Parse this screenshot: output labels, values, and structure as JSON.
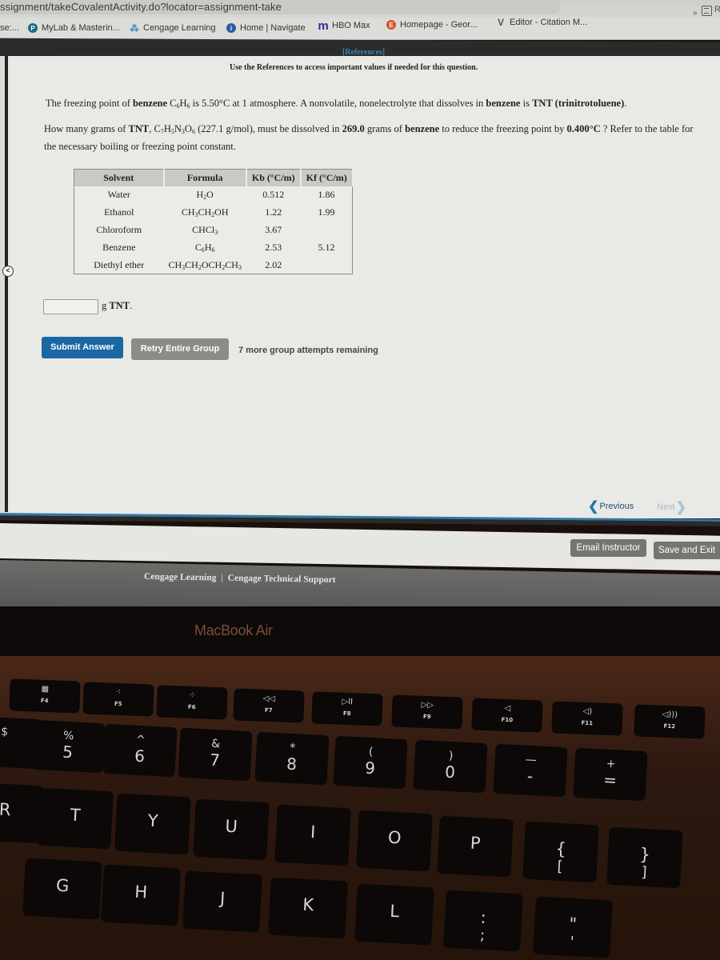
{
  "browser": {
    "url": "ssignment/takeCovalentActivity.do?locator=assignment-take",
    "bookmarks_overflow_left": "se:...",
    "bookmarks": [
      {
        "label": "MyLab & Masterin...",
        "icon": "pearson-icon"
      },
      {
        "label": "Cengage Learning",
        "icon": "cengage-icon"
      },
      {
        "label": "Home | Navigate",
        "icon": "navigate-icon"
      },
      {
        "label": "HBO Max",
        "icon": "hbo-max-icon"
      },
      {
        "label": "Homepage - Geor...",
        "icon": "georgia-icon"
      },
      {
        "label": "Editor - Citation M...",
        "icon": "citation-machine-icon"
      }
    ],
    "overflow_chevron": "»",
    "reading_list_label": "R"
  },
  "page": {
    "references_link": "[References]",
    "references_note": "Use the References to access important values if needed for this question.",
    "question_intro": {
      "t1": "The freezing point of ",
      "b1": "benzene",
      "t2": " C",
      "s1": "6",
      "t3": "H",
      "s2": "6",
      "t4": " is 5.50°C at 1 atmosphere. A nonvolatile, nonelectrolyte that dissolves in ",
      "b2": "benzene",
      "t5": " is ",
      "b3": "TNT (trinitrotoluene)",
      "t6": "."
    },
    "question_body": {
      "t1": "How many grams of ",
      "b1": "TNT",
      "t2": ", C",
      "s1": "7",
      "t3": "H",
      "s2": "5",
      "t4": "N",
      "s3": "3",
      "t5": "O",
      "s4": "6",
      "t6": " (227.1 g/mol), must be dissolved in ",
      "b2": "269.0",
      "t7": " grams of ",
      "b3": "benzene",
      "t8": " to reduce the freezing point by ",
      "b4": "0.400°C",
      "t9": " ? Refer to the table for the necessary boiling or freezing point constant."
    },
    "table": {
      "headers": {
        "solvent": "Solvent",
        "formula": "Formula",
        "kb": "Kb (°C/m)",
        "kf": "Kf (°C/m)"
      },
      "rows": [
        {
          "solvent": "Water",
          "formula": "H2O",
          "kb": "0.512",
          "kf": "1.86"
        },
        {
          "solvent": "Ethanol",
          "formula": "CH3CH2OH",
          "kb": "1.22",
          "kf": "1.99"
        },
        {
          "solvent": "Chloroform",
          "formula": "CHCl3",
          "kb": "3.67",
          "kf": ""
        },
        {
          "solvent": "Benzene",
          "formula": "C6H6",
          "kb": "2.53",
          "kf": "5.12"
        },
        {
          "solvent": "Diethyl ether",
          "formula": "CH3CH2OCH2CH3",
          "kb": "2.02",
          "kf": ""
        }
      ]
    },
    "answer": {
      "value": "",
      "unit_prefix": "g ",
      "unit": "TNT",
      "unit_suffix": "."
    },
    "buttons": {
      "submit": "Submit Answer",
      "retry": "Retry Entire Group",
      "attempts": "7 more group attempts remaining"
    },
    "nav": {
      "previous": "Previous",
      "next": "Next"
    },
    "actions": {
      "email": "Email Instructor",
      "save": "Save and Exit"
    },
    "footer": {
      "left": "Cengage Learning",
      "separator": "|",
      "right": "Cengage Technical Support"
    },
    "colors": {
      "primary": "#1b67a4",
      "secondary": "#8b8b88",
      "link": "#3d84b0"
    }
  },
  "device": {
    "label": "MacBook Air",
    "fkeys": [
      {
        "icon": "▦",
        "label": "F4",
        "name": "launchpad"
      },
      {
        "icon": "⁖",
        "label": "F5",
        "name": "keyboard-dim"
      },
      {
        "icon": "⁘",
        "label": "F6",
        "name": "keyboard-bright"
      },
      {
        "icon": "◁◁",
        "label": "F7",
        "name": "rewind"
      },
      {
        "icon": "▷II",
        "label": "F8",
        "name": "play-pause"
      },
      {
        "icon": "▷▷",
        "label": "F9",
        "name": "fast-forward"
      },
      {
        "icon": "◁",
        "label": "F10",
        "name": "mute"
      },
      {
        "icon": "◁)",
        "label": "F11",
        "name": "volume-down"
      },
      {
        "icon": "◁)))",
        "label": "F12",
        "name": "volume-up"
      }
    ],
    "number_keys": [
      {
        "top": "$",
        "bot": ""
      },
      {
        "top": "%",
        "bot": "5"
      },
      {
        "top": "^",
        "bot": "6"
      },
      {
        "top": "&",
        "bot": "7"
      },
      {
        "top": "*",
        "bot": "8"
      },
      {
        "top": "(",
        "bot": "9"
      },
      {
        "top": ")",
        "bot": "0"
      },
      {
        "top": "—",
        "bot": "-"
      },
      {
        "top": "+",
        "bot": "="
      }
    ],
    "top_letters": [
      {
        "top": "R",
        "bot": ""
      },
      {
        "top": "T",
        "bot": ""
      },
      {
        "top": "Y",
        "bot": ""
      },
      {
        "top": "U",
        "bot": ""
      },
      {
        "top": "I",
        "bot": ""
      },
      {
        "top": "O",
        "bot": ""
      },
      {
        "top": "P",
        "bot": ""
      },
      {
        "top": "{",
        "bot": "["
      },
      {
        "top": "}",
        "bot": "]"
      }
    ],
    "home_letters": [
      {
        "top": "G",
        "bot": ""
      },
      {
        "top": "H",
        "bot": ""
      },
      {
        "top": "J",
        "bot": ""
      },
      {
        "top": "K",
        "bot": ""
      },
      {
        "top": "L",
        "bot": ""
      },
      {
        "top": ":",
        "bot": ";"
      },
      {
        "top": "\"",
        "bot": "'"
      }
    ]
  }
}
